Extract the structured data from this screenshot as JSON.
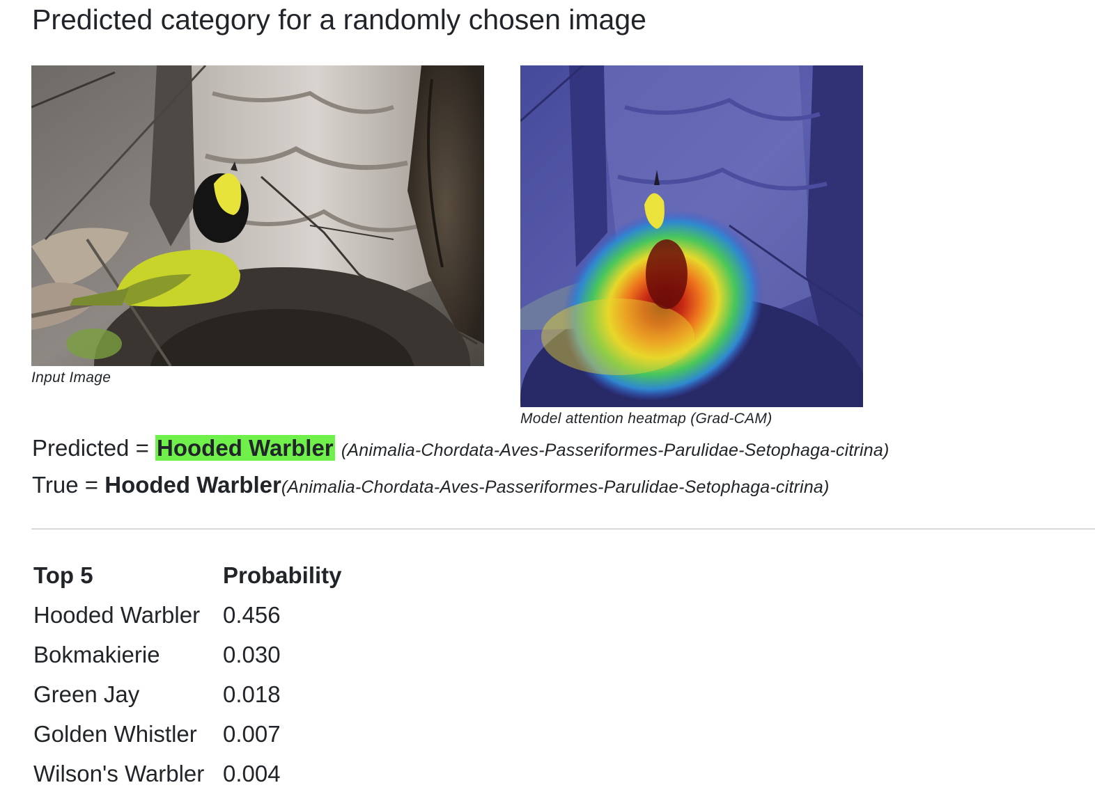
{
  "page": {
    "title": "Predicted category for a randomly chosen image"
  },
  "figures": {
    "input_caption": "Input Image",
    "heatmap_caption": "Model attention heatmap (Grad-CAM)"
  },
  "prediction": {
    "predicted_label": "Predicted = ",
    "predicted_name": "Hooded Warbler",
    "predicted_taxonomy": "(Animalia-Chordata-Aves-Passeriformes-Parulidae-Setophaga-citrina)",
    "true_label": "True = ",
    "true_name": "Hooded Warbler",
    "true_taxonomy": "(Animalia-Chordata-Aves-Passeriformes-Parulidae-Setophaga-citrina)",
    "highlight_color": "#6ff04a"
  },
  "top5": {
    "headers": [
      "Top 5",
      "Probability"
    ],
    "rows": [
      {
        "name": "Hooded Warbler",
        "prob": "0.456"
      },
      {
        "name": "Bokmakierie",
        "prob": "0.030"
      },
      {
        "name": "Green Jay",
        "prob": "0.018"
      },
      {
        "name": "Golden Whistler",
        "prob": "0.007"
      },
      {
        "name": "Wilson's Warbler",
        "prob": "0.004"
      }
    ]
  }
}
